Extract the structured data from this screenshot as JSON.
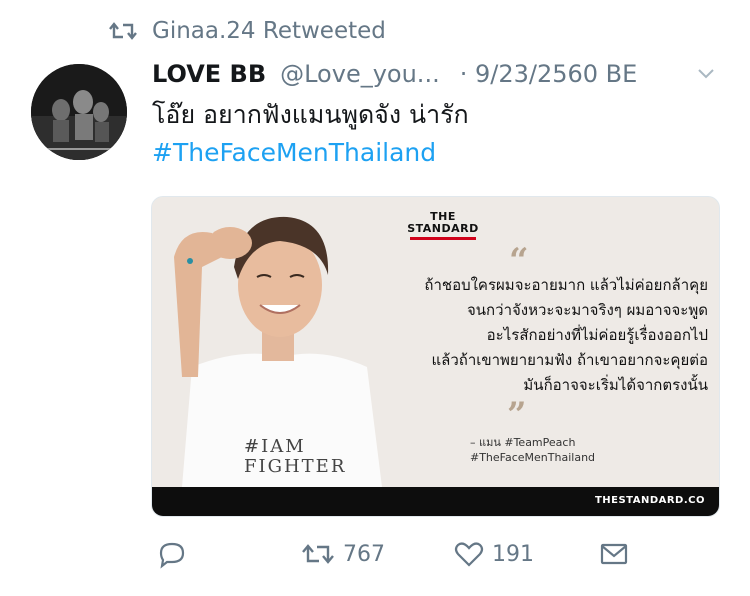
{
  "retweet": {
    "icon": "retweet-icon",
    "text": "Ginaa.24 Retweeted"
  },
  "tweet": {
    "author_name": "LOVE BB",
    "author_handle": "@Love_you...",
    "date": "· 9/23/2560 BE",
    "text": "โอ๊ย อยากฟังแมนพูดจัง น่ารัก",
    "hashtag": "#TheFaceMenThailand"
  },
  "card": {
    "brand": "THE STANDARD",
    "quote_lines": [
      "ถ้าชอบใครผมจะอายมาก แล้วไม่ค่อยกล้าคุย",
      "จนกว่าจังหวะจะมาจริงๆ ผมอาจจะพูด",
      "อะไรสักอย่างที่ไม่ค่อยรู้เรื่องออกไป",
      "แล้วถ้าเขาพยายามฟัง ถ้าเขาอยากจะคุยต่อ",
      "มันก็อาจจะเริ่มได้จากตรงนั้น"
    ],
    "attribution": "– แมน #TeamPeach",
    "attribution_tag": "#TheFaceMenThailand",
    "shirt_text_1": "#IAM",
    "shirt_text_2": "FIGHTER",
    "site": "THESTANDARD.CO"
  },
  "actions": {
    "reply_count": "",
    "retweet_count": "767",
    "like_count": "191"
  },
  "colors": {
    "link": "#1da1f2",
    "muted": "#657786",
    "card_bg": "#eeeae6",
    "brand_red": "#d0021b"
  }
}
